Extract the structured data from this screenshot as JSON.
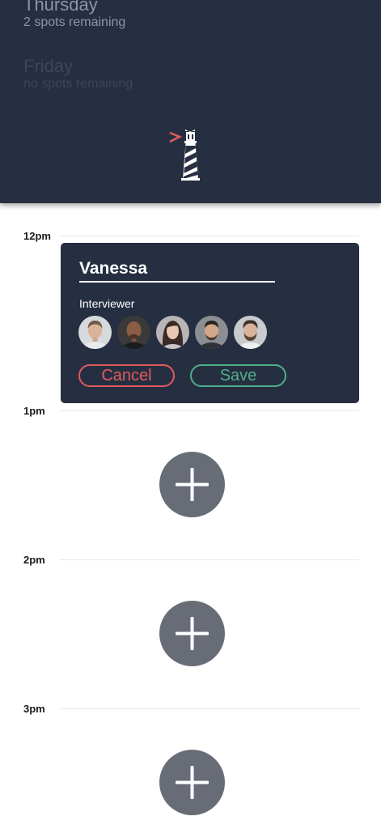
{
  "days": [
    {
      "name": "Thursday",
      "spots": "2 spots remaining",
      "status": "available"
    },
    {
      "name": "Friday",
      "spots": "no spots remaining",
      "status": "full"
    }
  ],
  "logo": {
    "icon": "lighthouse-icon",
    "accent_color": "#e15a5e"
  },
  "timeline": {
    "labels": [
      "12pm",
      "1pm",
      "2pm",
      "3pm"
    ]
  },
  "booking": {
    "name": "Vanessa",
    "interviewer_label": "Interviewer",
    "interviewer_avatars": [
      "avatar-1",
      "avatar-2",
      "avatar-3",
      "avatar-4",
      "avatar-5"
    ],
    "cancel_label": "Cancel",
    "save_label": "Save"
  },
  "add_slot": {
    "icon": "plus-icon"
  },
  "colors": {
    "panel_bg": "#262f41",
    "cancel": "#e15a5e",
    "save": "#4fae8a",
    "add_button": "#676c76"
  }
}
